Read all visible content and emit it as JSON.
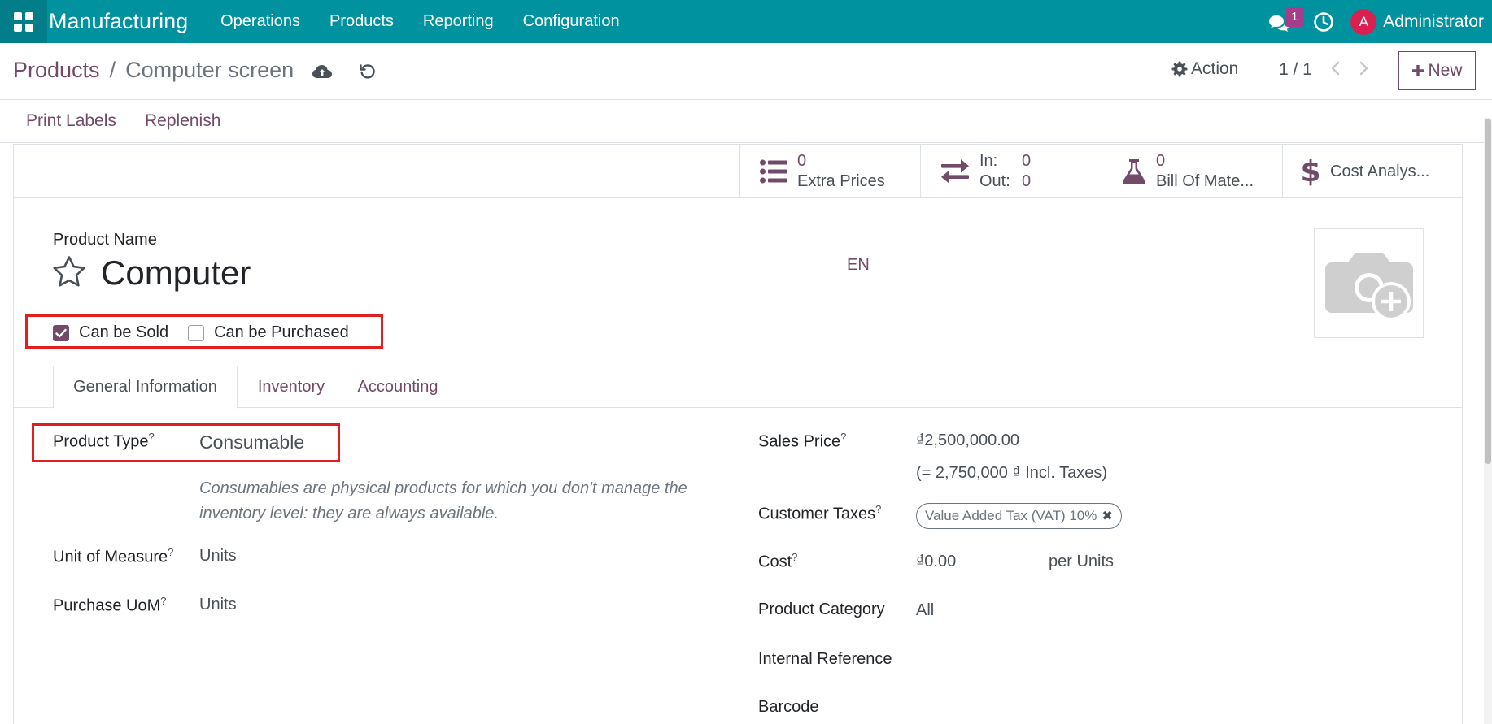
{
  "navbar": {
    "app_name": "Manufacturing",
    "menu": [
      "Operations",
      "Products",
      "Reporting",
      "Configuration"
    ],
    "chat_count": "1",
    "user_initial": "A",
    "user_name": "Administrator",
    "color": "#00929e"
  },
  "breadcrumb": {
    "parent": "Products",
    "separator": "/",
    "current": "Computer screen"
  },
  "control": {
    "action_label": "Action",
    "pager": "1 / 1",
    "new_label": "New"
  },
  "header_buttons": [
    "Print Labels",
    "Replenish"
  ],
  "smart_buttons": {
    "extra_prices": {
      "value": "0",
      "label": "Extra Prices"
    },
    "in_out": {
      "in_label": "In:",
      "in_value": "0",
      "out_label": "Out:",
      "out_value": "0"
    },
    "bom": {
      "value": "0",
      "label": "Bill Of Mate..."
    },
    "cost": {
      "label": "Cost Analys..."
    }
  },
  "product": {
    "name_label": "Product Name",
    "name": "Computer",
    "lang": "EN",
    "can_be_sold_label": "Can be Sold",
    "can_be_sold": true,
    "can_be_purchased_label": "Can be Purchased",
    "can_be_purchased": false
  },
  "tabs": [
    "General Information",
    "Inventory",
    "Accounting"
  ],
  "general": {
    "product_type_label": "Product Type",
    "product_type": "Consumable",
    "product_type_help": "Consumables are physical products for which you don't manage the inventory level: they are always available.",
    "uom_label": "Unit of Measure",
    "uom": "Units",
    "purchase_uom_label": "Purchase UoM",
    "purchase_uom": "Units",
    "sales_price_label": "Sales Price",
    "sales_price": "₫2,500,000.00",
    "sales_price_incl": "(= 2,750,000 ₫ Incl. Taxes)",
    "customer_taxes_label": "Customer Taxes",
    "customer_tax_tag": "Value Added Tax (VAT) 10%",
    "cost_label": "Cost",
    "cost": "₫0.00",
    "cost_unit": "per Units",
    "category_label": "Product Category",
    "category": "All",
    "internal_ref_label": "Internal Reference",
    "barcode_label": "Barcode",
    "help_marker": "?"
  },
  "colors": {
    "accent": "#714b67",
    "highlight": "#e02020"
  }
}
